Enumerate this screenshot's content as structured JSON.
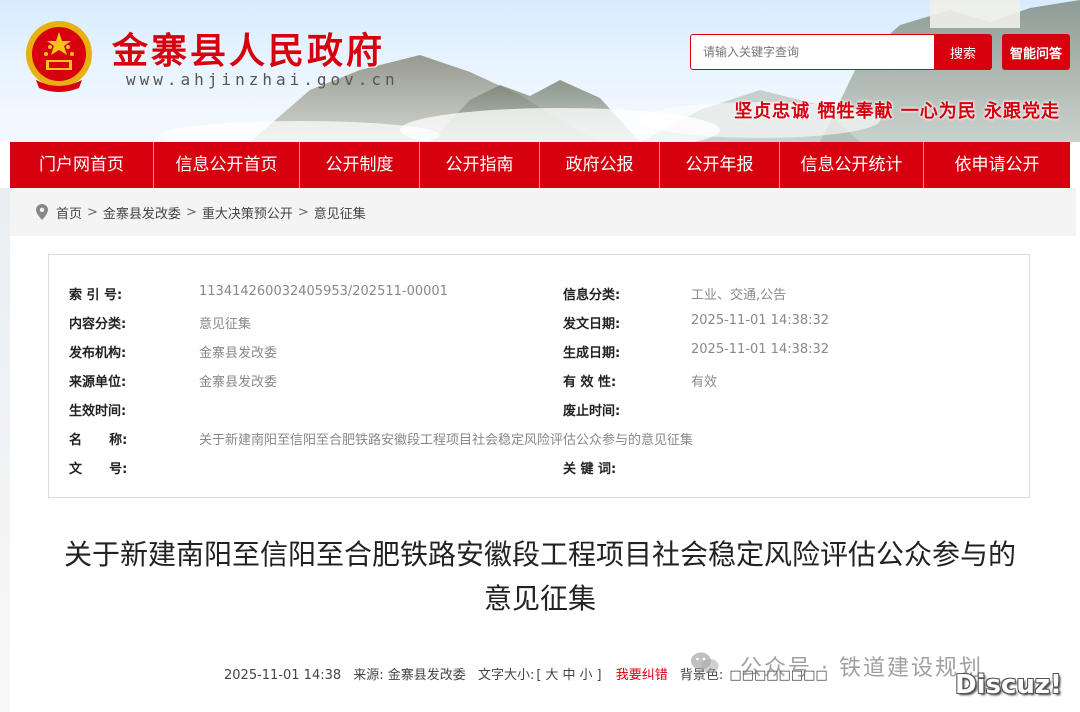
{
  "header": {
    "site_title": "金寨县人民政府",
    "site_url": "www.ahjinzhai.gov.cn",
    "search_placeholder": "请输入关键字查询",
    "search_label": "搜索",
    "qa_label": "智能问答",
    "slogan": "坚贞忠诚  牺牲奉献  一心为民  永跟党走",
    "brand_color": "#d6000f"
  },
  "nav": {
    "items": [
      {
        "label": "门户网首页"
      },
      {
        "label": "信息公开首页"
      },
      {
        "label": "公开制度"
      },
      {
        "label": "公开指南"
      },
      {
        "label": "政府公报"
      },
      {
        "label": "公开年报"
      },
      {
        "label": "信息公开统计"
      },
      {
        "label": "依申请公开"
      }
    ]
  },
  "breadcrumb": {
    "items": [
      "首页",
      "金寨县发改委",
      "重大决策预公开",
      "意见征集"
    ],
    "separator": ">"
  },
  "meta": {
    "index_label": "索 引 号:",
    "index_value": "113414260032405953/202511-00001",
    "category_label": "信息分类:",
    "category_value": "工业、交通,公告",
    "content_label": "内容分类:",
    "content_value": "意见征集",
    "issue_date_label": "发文日期:",
    "issue_date_value": "2025-11-01 14:38:32",
    "publisher_label": "发布机构:",
    "publisher_value": "金寨县发改委",
    "gen_date_label": "生成日期:",
    "gen_date_value": "2025-11-01 14:38:32",
    "source_label": "来源单位:",
    "source_value": "金寨县发改委",
    "validity_label": "有 效 性:",
    "validity_value": "有效",
    "effective_label": "生效时间:",
    "effective_value": "",
    "abolish_label": "废止时间:",
    "abolish_value": "",
    "name_label": "名      称:",
    "name_value": "关于新建南阳至信阳至合肥铁路安徽段工程项目社会稳定风险评估公众参与的意见征集",
    "docno_label": "文      号:",
    "docno_value": "",
    "keywords_label": "关 键 词:",
    "keywords_value": ""
  },
  "article": {
    "title_line1": "关于新建南阳至信阳至合肥铁路安徽段工程项目社会稳定风险评估公众参与的",
    "title_line2": "意见征集",
    "date": "2025-11-01 14:38",
    "source": "来源:  金寨县发改委",
    "font_size_label": "文字大小:",
    "font_size_open": "[",
    "font_size_large": "大",
    "font_size_medium": "中",
    "font_size_small": "小",
    "font_size_close": "]",
    "correction_label": "我要纠错",
    "background_label": "背景色:",
    "background_swatches": "□□□□□□□□"
  },
  "watermarks": {
    "wechat_text": "公众号 · 铁道建设规划",
    "wechat_icon": "wechat-icon",
    "discuz": "Discuz!"
  }
}
